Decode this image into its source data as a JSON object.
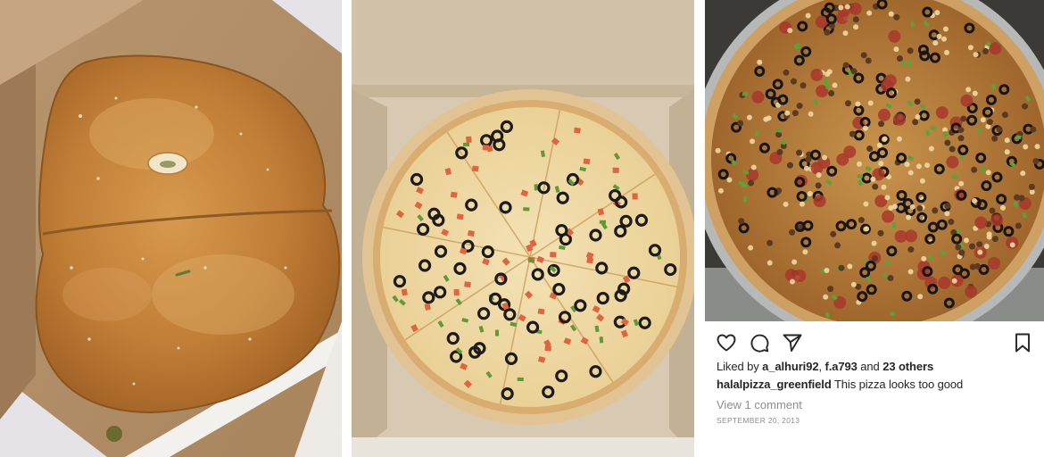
{
  "post": {
    "liked_by_prefix": "Liked by",
    "liker_one": "a_alhuri92",
    "separator": ",",
    "liker_two": "f.a793",
    "and_word": "and",
    "others": "23 others",
    "username": "halalpizza_greenfield",
    "caption_text": "This pizza looks too good",
    "view_comments": "View 1 comment",
    "date": "SEPTEMBER 20, 2013"
  },
  "icons": {
    "like": "heart-icon",
    "comment": "comment-icon",
    "share": "send-icon",
    "save": "bookmark-icon"
  },
  "colors": {
    "text": "#262626",
    "muted": "#8e8e8e",
    "crust": "#c98a45",
    "cardboard": "#c9ad88"
  }
}
